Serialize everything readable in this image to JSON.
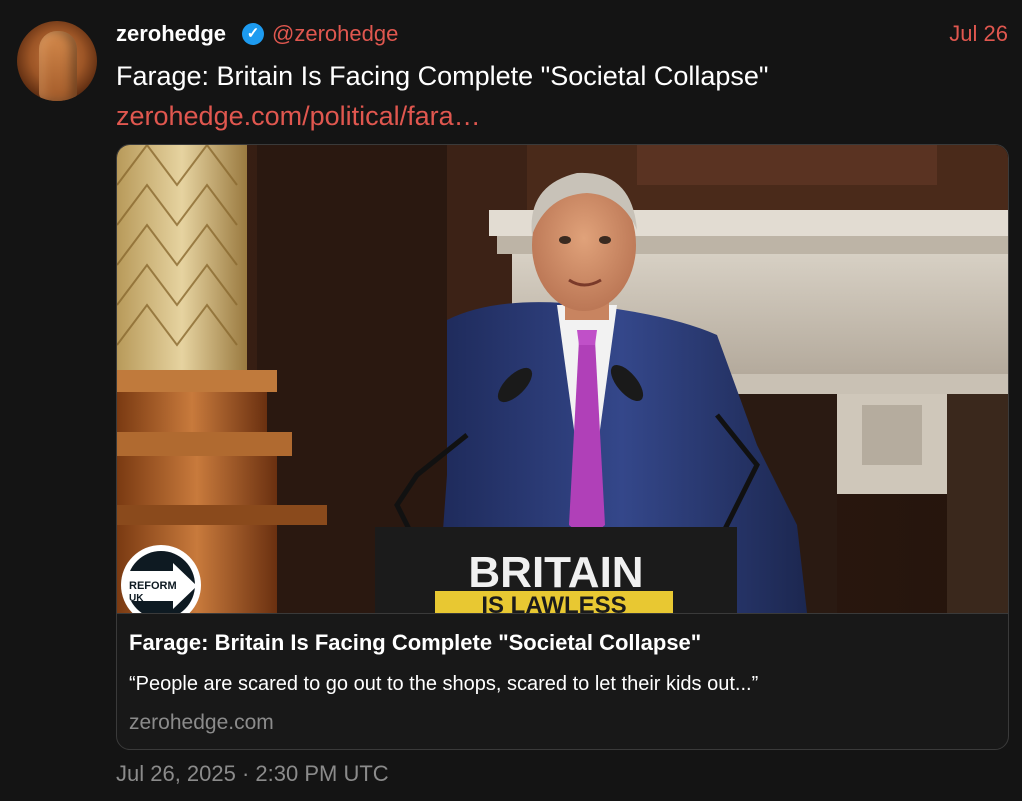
{
  "post": {
    "author_name": "zerohedge",
    "handle": "@zerohedge",
    "date": "Jul 26",
    "text": "Farage: Britain Is Facing Complete \"Societal Collapse\"",
    "link_text": "zerohedge.com/political/fara…",
    "timestamp": "Jul 26, 2025 · 2:30 PM UTC"
  },
  "card": {
    "title": "Farage: Britain Is Facing Complete \"Societal Collapse\"",
    "description": "“People are scared to go out to the shops, scared to let their kids out...”",
    "domain": "zerohedge.com",
    "image": {
      "lectern_line1": "BRITAIN",
      "lectern_line2": "IS LAWLESS",
      "logo_line1": "REFORM",
      "logo_line2": "UK"
    }
  },
  "icons": {
    "verified": "verified-check-icon"
  },
  "colors": {
    "accent": "#e0574f",
    "verified": "#1d9bf0",
    "muted": "#8b8b8b",
    "background": "#141414"
  }
}
